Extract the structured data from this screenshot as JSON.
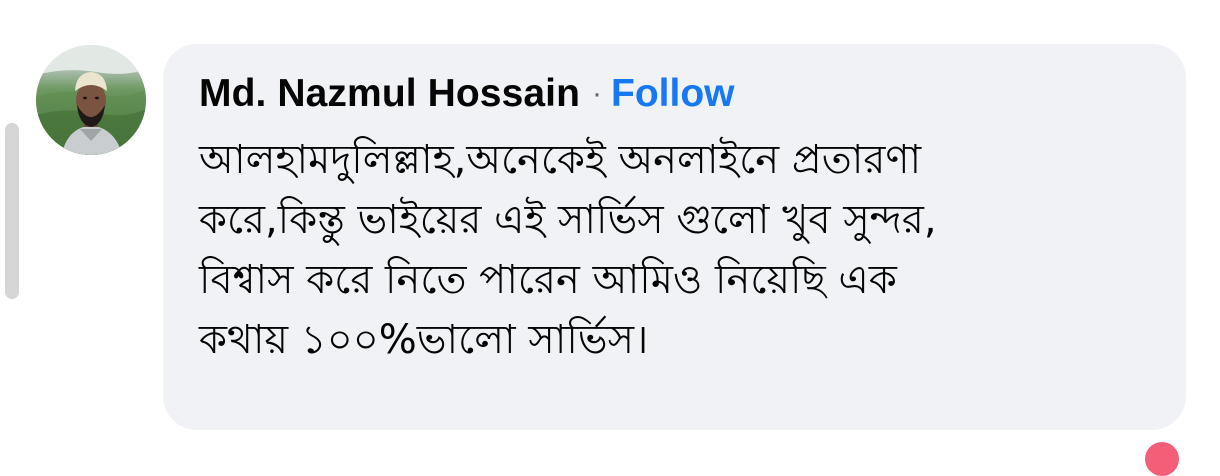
{
  "comment": {
    "author": "Md. Nazmul Hossain",
    "separator": "·",
    "follow_label": "Follow",
    "lines": [
      "আলহামদুলিল্লাহ,অনেকেই অনলাইনে প্রতারণা",
      "করে,কিন্তু ভাইয়ের এই সার্ভিস গুলো খুব সুন্দর,",
      "বিশ্বাস করে নিতে পারেন আমিও নিয়েছি এক",
      "কথায় ১০০%ভালো সার্ভিস।"
    ]
  },
  "colors": {
    "bubble_background": "#f0f2f5",
    "follow_link": "#1877f2",
    "text": "#050505",
    "reaction_hint": "#f3425f"
  },
  "icons": {
    "avatar": "profile-photo",
    "reaction": "reaction-icon"
  }
}
